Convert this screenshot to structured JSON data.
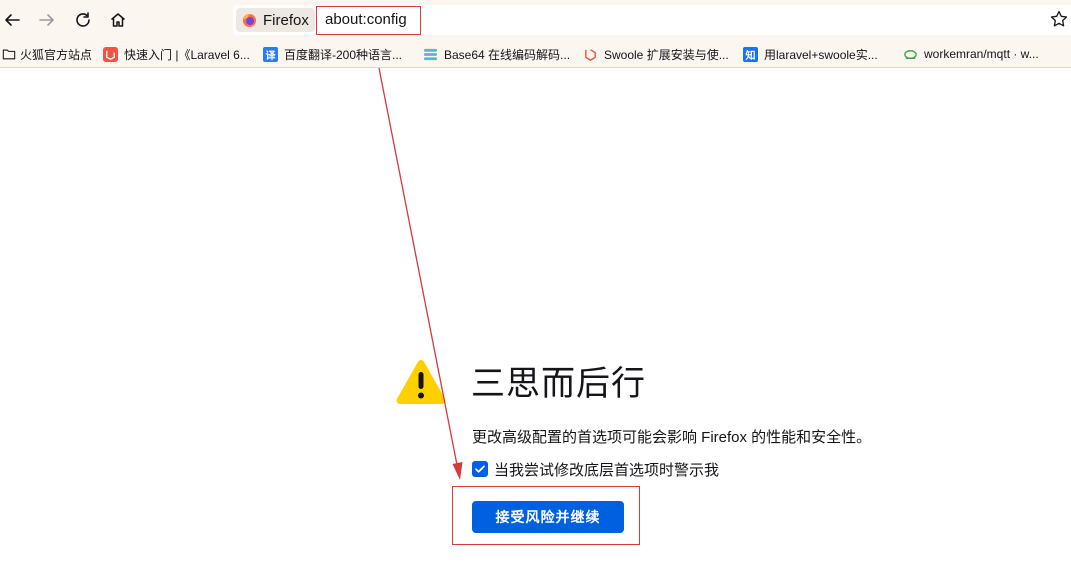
{
  "toolbar": {
    "back_icon": "back-arrow-icon",
    "forward_icon": "forward-arrow-icon",
    "reload_icon": "reload-icon",
    "home_icon": "home-icon",
    "identity_label": "Firefox",
    "url": "about:config",
    "bookmark_star_icon": "star-icon"
  },
  "bookmarks": [
    {
      "label": "火狐官方站点",
      "icon": "folder-icon"
    },
    {
      "label": "快速入门 |《Laravel 6...",
      "icon": "laravel-icon"
    },
    {
      "label": "百度翻译-200种语言...",
      "icon": "translate-icon",
      "glyph": "译"
    },
    {
      "label": "Base64 在线编码解码...",
      "icon": "base64-icon"
    },
    {
      "label": "Swoole 扩展安装与使...",
      "icon": "laravel-icon"
    },
    {
      "label": "用laravel+swoole实...",
      "icon": "zhihu-icon",
      "glyph": "知"
    },
    {
      "label": "workemran/mqtt · w...",
      "icon": "mqtt-icon"
    }
  ],
  "warning": {
    "title": "三思而后行",
    "description": "更改高级配置的首选项可能会影响 Firefox 的性能和安全性。",
    "checkbox_label": "当我尝试修改底层首选项时警示我",
    "checkbox_checked": true,
    "accept_button": "接受风险并继续"
  },
  "colors": {
    "accent": "#0061e0",
    "annotation": "#d63a3a",
    "warning_yellow": "#ffd000"
  }
}
